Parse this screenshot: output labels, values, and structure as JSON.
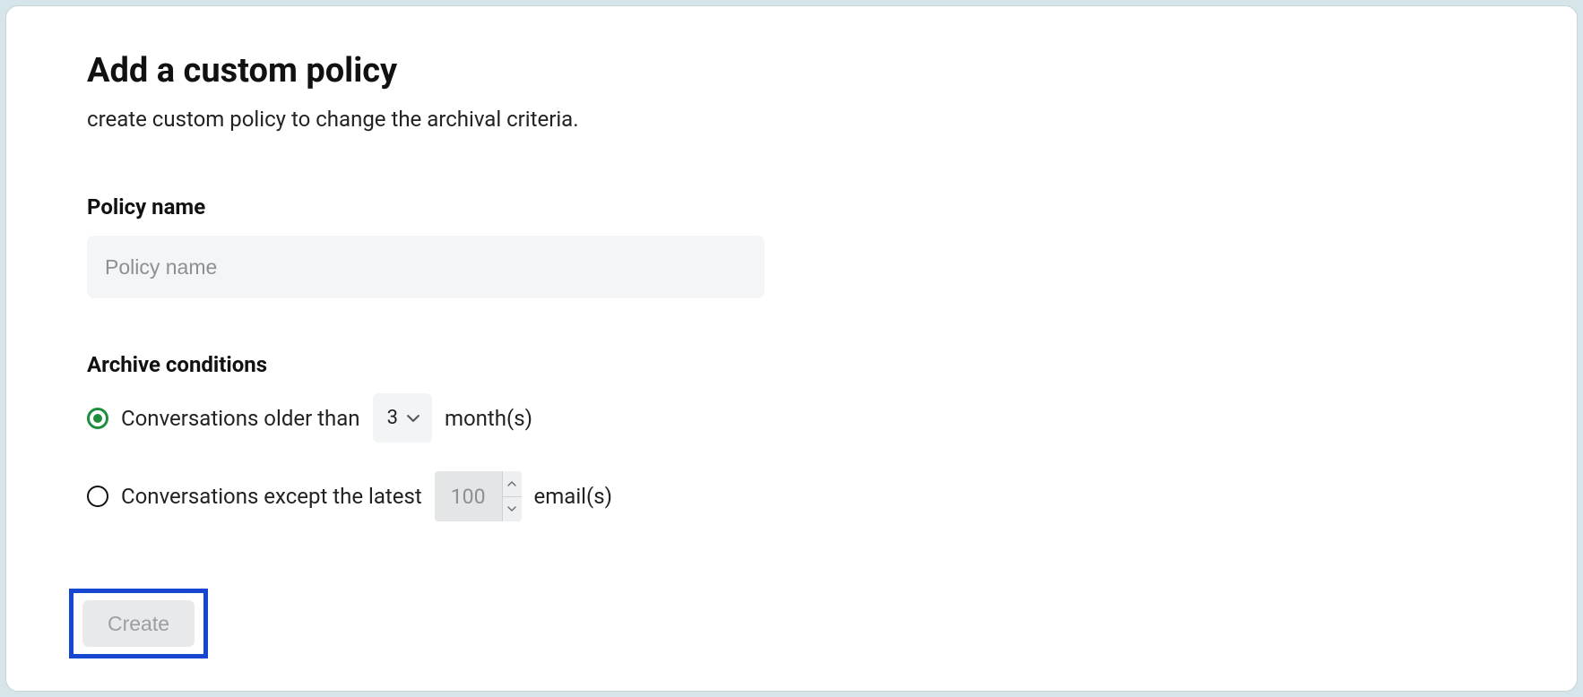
{
  "header": {
    "title": "Add a custom policy",
    "subtitle": "create custom policy to change the archival criteria."
  },
  "form": {
    "policy_name_label": "Policy name",
    "policy_name_placeholder": "Policy name",
    "policy_name_value": "",
    "archive_conditions_label": "Archive conditions",
    "condition_older": {
      "label_pre": "Conversations older than",
      "months_value": "3",
      "label_post": "month(s)",
      "selected": true
    },
    "condition_latest": {
      "label_pre": "Conversations except the latest",
      "count_value": "100",
      "label_post": "email(s)",
      "selected": false
    }
  },
  "actions": {
    "create_label": "Create"
  }
}
